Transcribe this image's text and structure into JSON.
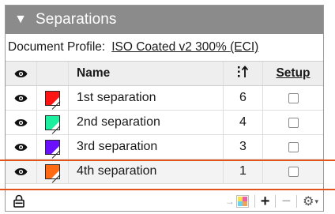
{
  "panel": {
    "title": "Separations",
    "collapse_glyph": "▼"
  },
  "profile": {
    "label": "Document Profile:",
    "value": "ISO Coated v2 300% (ECI)"
  },
  "table": {
    "headers": {
      "visibility_icon": "eye-icon",
      "name": "Name",
      "order_icon": "sort-order-icon",
      "setup": "Setup"
    },
    "rows": [
      {
        "name": "1st separation",
        "order": "6",
        "color": "#ff1414",
        "checked": false
      },
      {
        "name": "2nd separation",
        "order": "4",
        "color": "#1cf0a0",
        "checked": false
      },
      {
        "name": "3rd separation",
        "order": "3",
        "color": "#6a10ff",
        "checked": false
      },
      {
        "name": "4th separation",
        "order": "1",
        "color": "#ff6a12",
        "checked": false
      }
    ]
  },
  "toolbar": {
    "lock_icon": "lock-icon",
    "arrow_glyph": "→",
    "plus_glyph": "+",
    "minus_glyph": "−",
    "gear_glyph": "⚙",
    "gear_caret": "▾"
  },
  "colors": {
    "title_bar": "#8b8b8b",
    "highlight": "#e0541c"
  }
}
